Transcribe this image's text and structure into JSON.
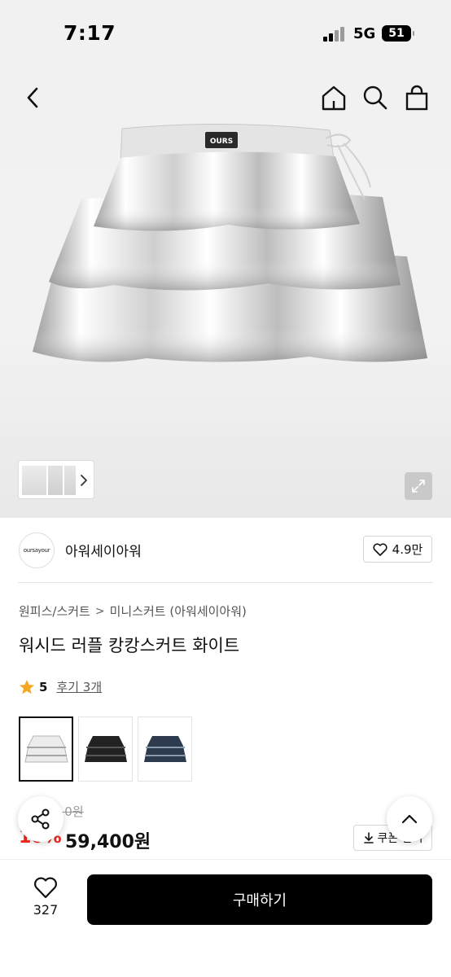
{
  "status_bar": {
    "time": "7:17",
    "network": "5G",
    "battery": "51"
  },
  "nav": {
    "back_icon": "chevron-left-icon",
    "home_icon": "home-icon",
    "search_icon": "search-icon",
    "cart_icon": "shopping-bag-icon"
  },
  "hero": {
    "patch_text": "OURS",
    "thumb_next_icon": "chevron-right-icon",
    "expand_icon": "expand-icon"
  },
  "seller": {
    "logo_text": "oursayour",
    "name": "아워세이아워",
    "likes": "4.9만"
  },
  "breadcrumb": {
    "level1": "원피스/스커트",
    "level2": "미니스커트 (아워세이아워)",
    "separator": ">"
  },
  "product": {
    "title": "워시드 러플 캉캉스커트 화이트",
    "rating": "5",
    "reviews": "후기 3개"
  },
  "color_options": [
    {
      "name": "white",
      "color": "#e6e6e6",
      "selected": true
    },
    {
      "name": "black",
      "color": "#222222",
      "selected": false
    },
    {
      "name": "denim",
      "color": "#2e3a4d",
      "selected": false
    }
  ],
  "price": {
    "original": "6 0원",
    "discount": "10%",
    "sale": "59,400원",
    "coupon_label": "쿠폰 받기"
  },
  "bottom": {
    "wish_count": "327",
    "buy_label": "구매하기"
  },
  "colors": {
    "accent_red": "#f0281e",
    "buy_button": "#000000",
    "star": "#f5a623"
  }
}
